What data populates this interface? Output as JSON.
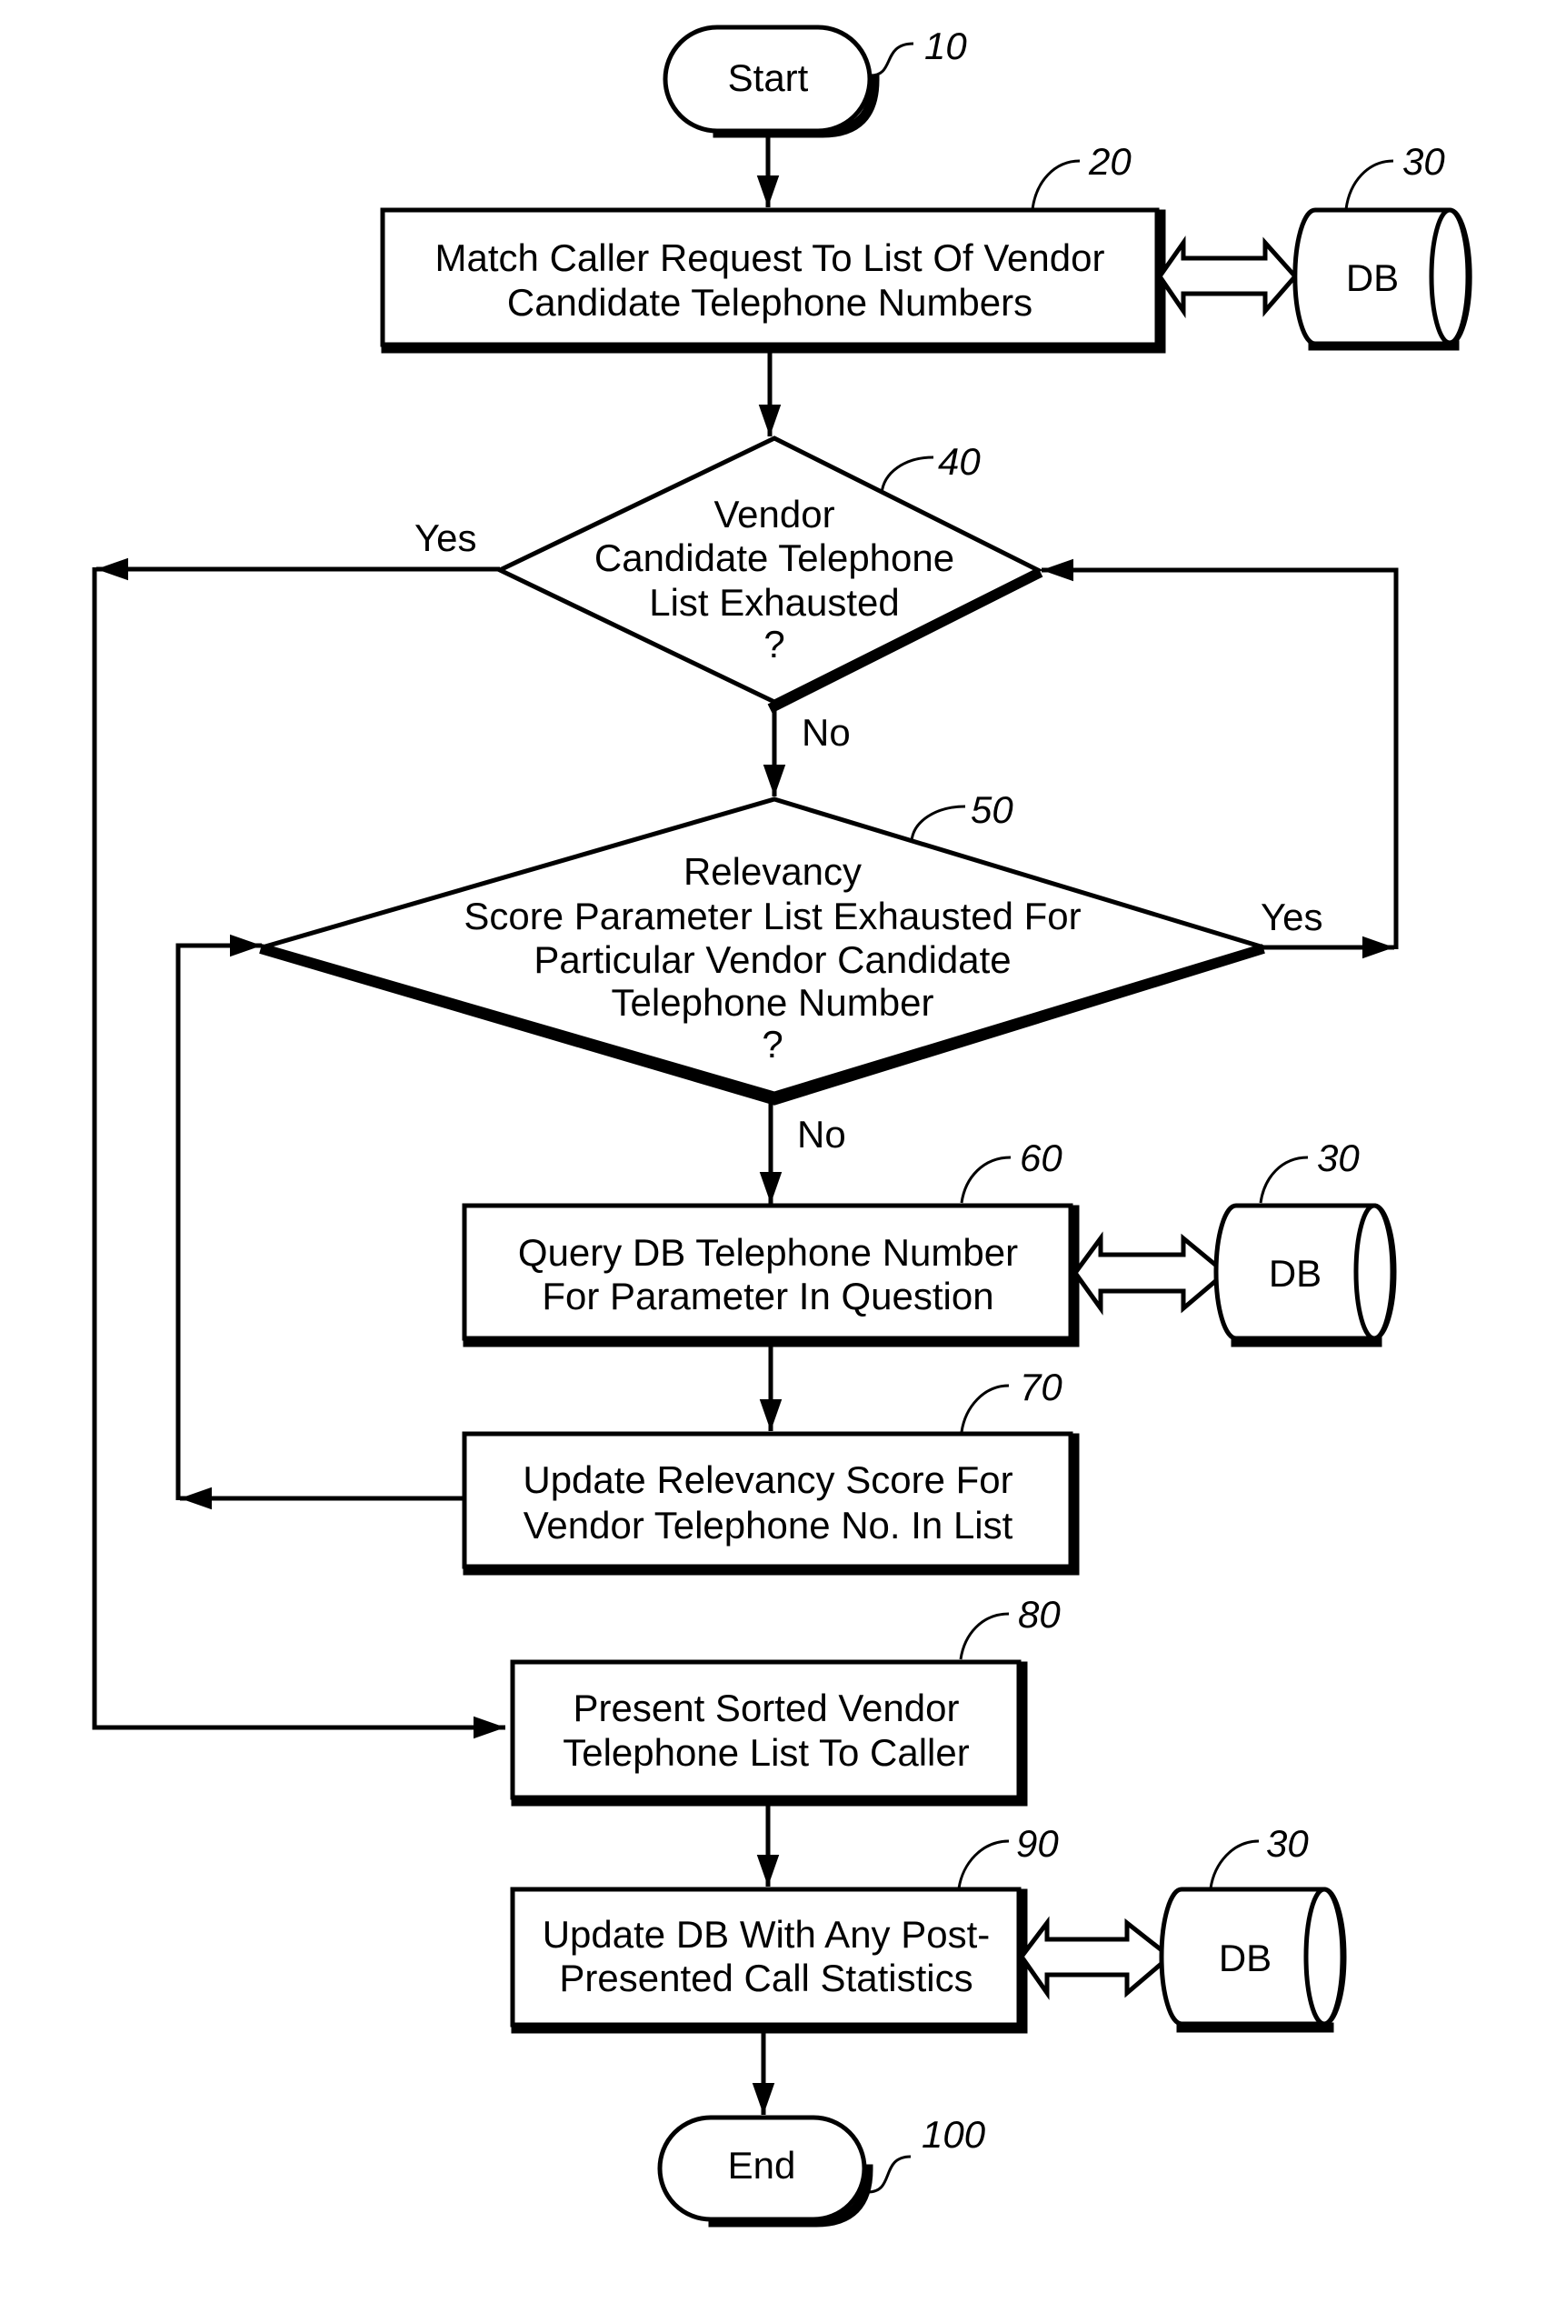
{
  "figure": {
    "type": "flowchart",
    "nodes": {
      "start": {
        "ref": "10",
        "shape": "terminal",
        "text": "Start"
      },
      "match": {
        "ref": "20",
        "shape": "process",
        "lines": [
          "Match Caller Request To List Of Vendor",
          "Candidate Telephone Numbers"
        ]
      },
      "db_top": {
        "ref": "30",
        "shape": "database",
        "text": "DB"
      },
      "vendor_list_check": {
        "ref": "40",
        "shape": "decision",
        "lines": [
          "Vendor",
          "Candidate Telephone",
          "List Exhausted",
          "?"
        ]
      },
      "relevancy_check": {
        "ref": "50",
        "shape": "decision",
        "lines": [
          "Relevancy",
          "Score Parameter List Exhausted For",
          "Particular Vendor Candidate",
          "Telephone Number",
          "?"
        ]
      },
      "query": {
        "ref": "60",
        "shape": "process",
        "lines": [
          "Query DB Telephone Number",
          "For Parameter In Question"
        ]
      },
      "db_mid": {
        "ref": "30",
        "shape": "database",
        "text": "DB"
      },
      "update_score": {
        "ref": "70",
        "shape": "process",
        "lines": [
          "Update Relevancy Score For",
          "Vendor Telephone No. In List"
        ]
      },
      "present": {
        "ref": "80",
        "shape": "process",
        "lines": [
          "Present Sorted Vendor",
          "Telephone List To Caller"
        ]
      },
      "update_db": {
        "ref": "90",
        "shape": "process",
        "lines": [
          "Update DB With Any Post-",
          "Presented Call Statistics"
        ]
      },
      "db_bottom": {
        "ref": "30",
        "shape": "database",
        "text": "DB"
      },
      "end": {
        "ref": "100",
        "shape": "terminal",
        "text": "End"
      }
    },
    "edge_labels": {
      "d40_yes": "Yes",
      "d40_no": "No",
      "d50_yes": "Yes",
      "d50_no": "No"
    },
    "edges": [
      {
        "from": "start",
        "to": "match"
      },
      {
        "from": "match",
        "to": "db_top",
        "bidirectional": true
      },
      {
        "from": "match",
        "to": "vendor_list_check"
      },
      {
        "from": "vendor_list_check",
        "to": "present",
        "label": "Yes"
      },
      {
        "from": "vendor_list_check",
        "to": "relevancy_check",
        "label": "No"
      },
      {
        "from": "relevancy_check",
        "to": "vendor_list_check",
        "label": "Yes"
      },
      {
        "from": "relevancy_check",
        "to": "query",
        "label": "No"
      },
      {
        "from": "query",
        "to": "db_mid",
        "bidirectional": true
      },
      {
        "from": "query",
        "to": "update_score"
      },
      {
        "from": "update_score",
        "to": "relevancy_check"
      },
      {
        "from": "present",
        "to": "update_db"
      },
      {
        "from": "update_db",
        "to": "db_bottom",
        "bidirectional": true
      },
      {
        "from": "update_db",
        "to": "end"
      }
    ]
  }
}
